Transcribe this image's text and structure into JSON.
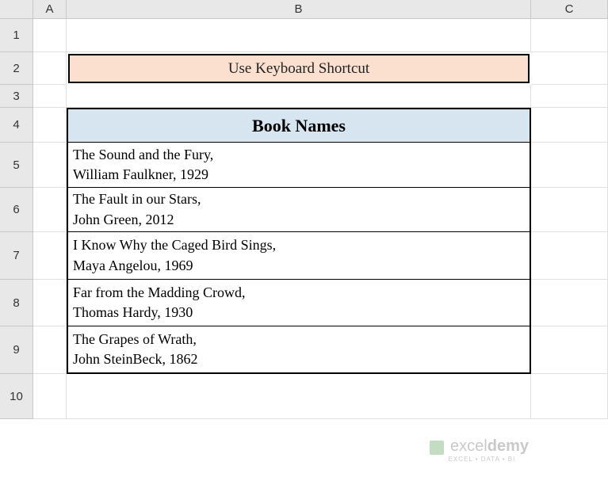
{
  "columns": [
    "A",
    "B",
    "C"
  ],
  "rows": [
    "1",
    "2",
    "3",
    "4",
    "5",
    "6",
    "7",
    "8",
    "9",
    "10"
  ],
  "title": "Use Keyboard Shortcut",
  "tableHeader": "Book Names",
  "books": [
    {
      "line1": "The Sound and the Fury,",
      "line2": "William Faulkner, 1929"
    },
    {
      "line1": "The Fault in our Stars,",
      "line2": "John Green, 2012"
    },
    {
      "line1": "I Know Why the Caged Bird Sings,",
      "line2": "Maya Angelou, 1969"
    },
    {
      "line1": "Far from the Madding Crowd,",
      "line2": "Thomas Hardy, 1930"
    },
    {
      "line1": "The Grapes of Wrath,",
      "line2": " John SteinBeck, 1862"
    }
  ],
  "watermark": {
    "brand1": "excel",
    "brand2": "demy",
    "tagline": "EXCEL • DATA • BI"
  }
}
